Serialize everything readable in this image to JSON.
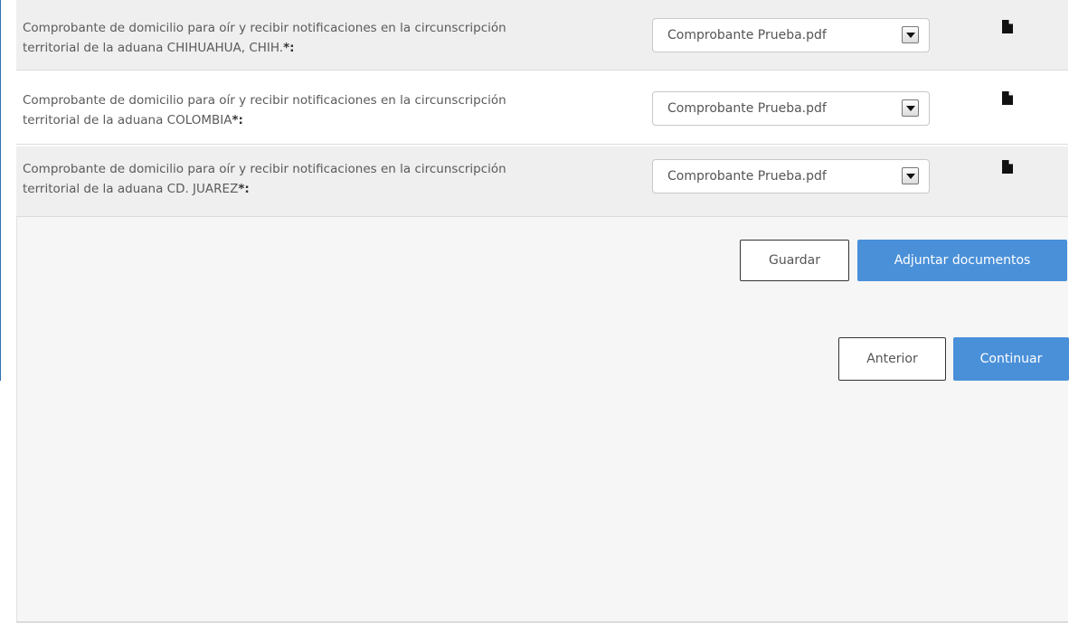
{
  "documents": [
    {
      "label_line1": "Comprobante de domicilio para oír y recibir notificaciones en la circunscripción",
      "label_line2": "territorial de la aduana CHIHUAHUA, CHIH.",
      "required_mark": "*:",
      "selected_file": "Comprobante Prueba.pdf"
    },
    {
      "label_line1": "Comprobante de domicilio para oír y recibir notificaciones en la circunscripción",
      "label_line2": "territorial de la aduana COLOMBIA",
      "required_mark": "*:",
      "selected_file": "Comprobante Prueba.pdf"
    },
    {
      "label_line1": "Comprobante de domicilio para oír y recibir notificaciones en la circunscripción",
      "label_line2": "territorial de la aduana CD. JUAREZ",
      "required_mark": "*:",
      "selected_file": "Comprobante Prueba.pdf"
    }
  ],
  "actions": {
    "save_label": "Guardar",
    "attach_label": "Adjuntar documentos"
  },
  "navigation": {
    "previous_label": "Anterior",
    "continue_label": "Continuar"
  },
  "icons": {
    "file": "file-icon",
    "dropdown": "chevron-down-icon"
  },
  "colors": {
    "primary": "#4a90d9",
    "row_gray": "#efefef",
    "frame": "#2c6fb5"
  }
}
